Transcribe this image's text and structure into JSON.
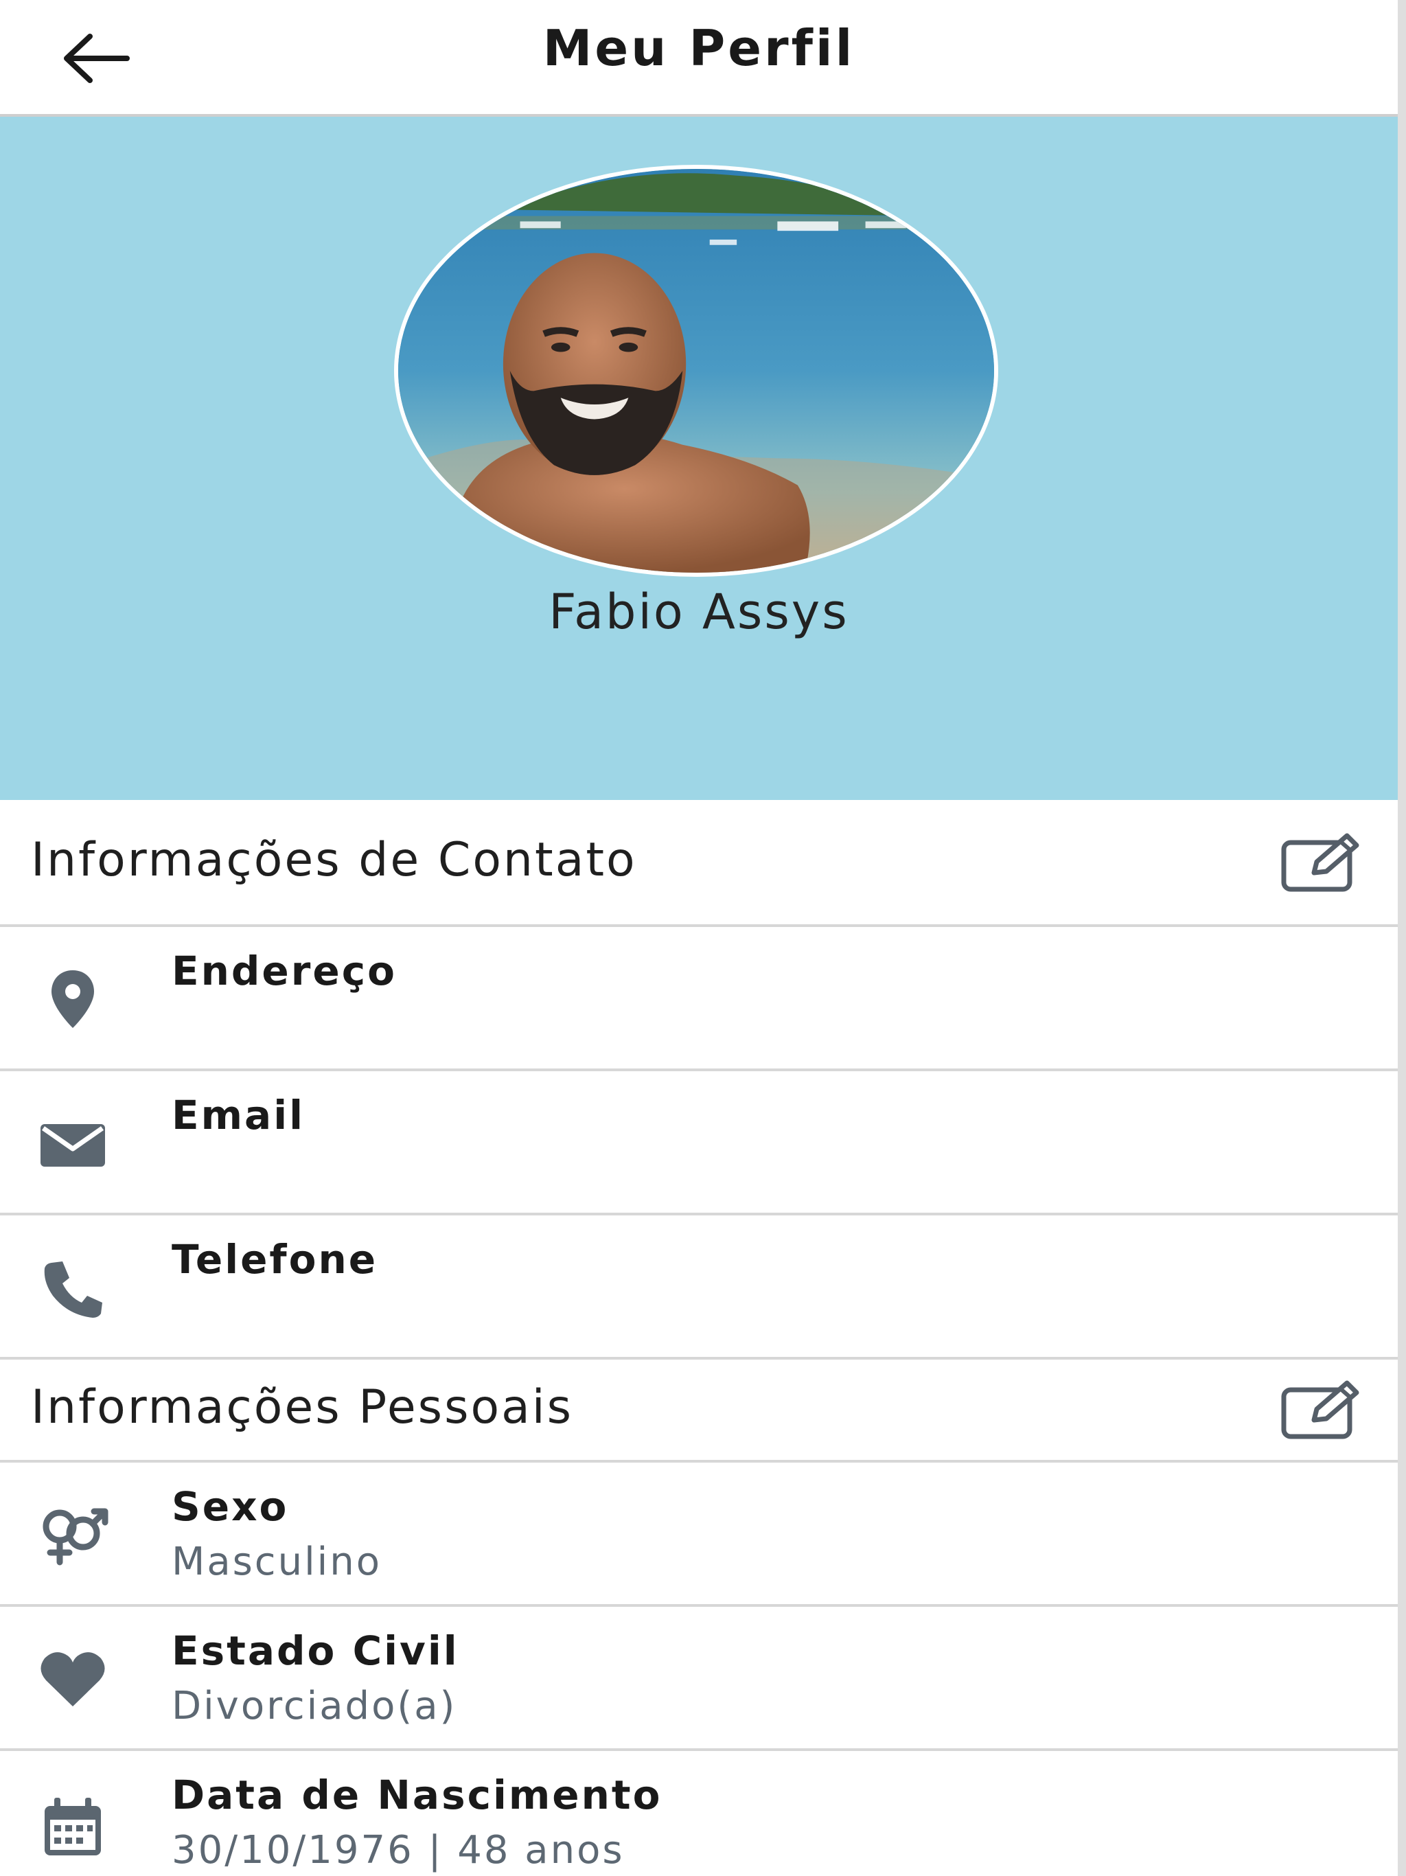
{
  "header": {
    "title": "Meu Perfil",
    "back_icon": "arrow-left-icon"
  },
  "profile": {
    "name": "Fabio Assys",
    "photo": "profile-photo-beach"
  },
  "colors": {
    "hero_bg": "#9ed6e6",
    "icon_gray": "#5b6670",
    "value_gray": "#5d6873",
    "divider": "#d7d7d7"
  },
  "contact_section": {
    "title": "Informações de Contato",
    "edit_icon": "edit-icon",
    "items": [
      {
        "label": "Endereço",
        "value": "",
        "icon": "location-pin-icon"
      },
      {
        "label": "Email",
        "value": "",
        "icon": "envelope-icon"
      },
      {
        "label": "Telefone",
        "value": "",
        "icon": "phone-icon"
      }
    ]
  },
  "personal_section": {
    "title": "Informações Pessoais",
    "edit_icon": "edit-icon",
    "items": [
      {
        "label": "Sexo",
        "value": "Masculino",
        "icon": "gender-icon"
      },
      {
        "label": "Estado Civil",
        "value": "Divorciado(a)",
        "icon": "heart-icon"
      },
      {
        "label": "Data de Nascimento",
        "value": "30/10/1976 | 48 anos",
        "icon": "calendar-icon"
      }
    ]
  }
}
